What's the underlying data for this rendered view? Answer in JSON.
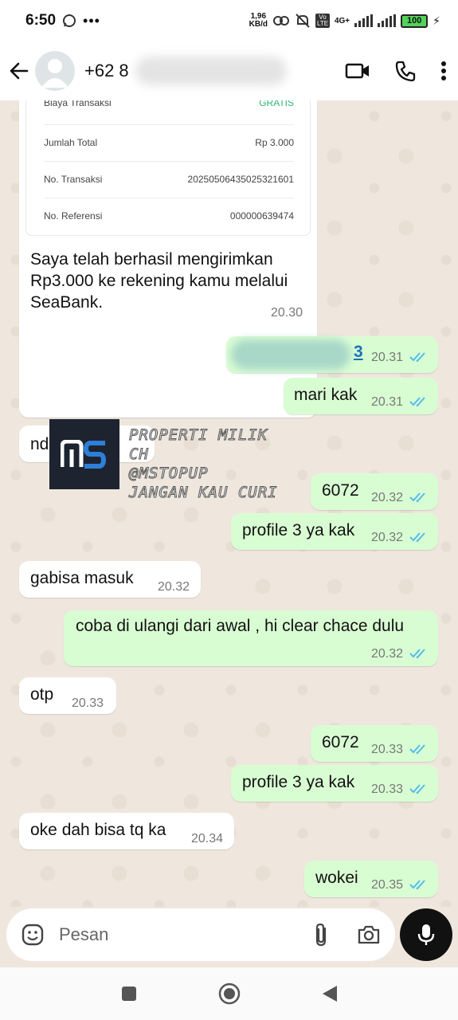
{
  "status_bar": {
    "time": "6:50",
    "net_speed_value": "1,96",
    "net_speed_unit": "KB/d",
    "network": "4G+",
    "volte": "Vo LTE",
    "battery": "100"
  },
  "header": {
    "contact_name": "+62 8"
  },
  "receipt": {
    "rows": [
      {
        "label": "Biaya Transaksi",
        "value": "GRATIS"
      },
      {
        "label": "Jumlah Total",
        "value": "Rp 3.000"
      },
      {
        "label": "No. Transaksi",
        "value": "20250506435025321601"
      },
      {
        "label": "No. Referensi",
        "value": "000000639474"
      }
    ],
    "message": "Saya telah berhasil mengirimkan Rp3.000 ke rekening kamu melalui SeaBank.",
    "time": "20.30"
  },
  "watermark": {
    "line1": "PROPERTI MILIK CH",
    "line2": "@MSTOPUP",
    "line3": "JANGAN KAU CURI"
  },
  "messages": [
    {
      "dir": "out",
      "text": "3",
      "time": "20.31"
    },
    {
      "dir": "out",
      "text": "mari kak",
      "time": "20.31"
    },
    {
      "dir": "in",
      "text": "nd        ak",
      "time": ""
    },
    {
      "dir": "out",
      "text": "6072",
      "time": "20.32"
    },
    {
      "dir": "out",
      "text": "profile 3 ya kak",
      "time": "20.32"
    },
    {
      "dir": "in",
      "text": "gabisa masuk",
      "time": "20.32"
    },
    {
      "dir": "out",
      "text": "coba di ulangi dari awal , hi clear chace dulu",
      "time": "20.32"
    },
    {
      "dir": "in",
      "text": "otp",
      "time": "20.33"
    },
    {
      "dir": "out",
      "text": "6072",
      "time": "20.33"
    },
    {
      "dir": "out",
      "text": "profile 3 ya kak",
      "time": "20.33"
    },
    {
      "dir": "in",
      "text": "oke dah bisa tq ka",
      "time": "20.34"
    },
    {
      "dir": "out",
      "text": "wokei",
      "time": "20.35"
    }
  ],
  "input": {
    "placeholder": "Pesan"
  },
  "colors": {
    "outgoing_bubble": "#d9fdd3",
    "incoming_bubble": "#ffffff",
    "chat_background": "#efe7de",
    "read_ticks": "#53bdeb",
    "gratis": "#2bb673"
  },
  "icons": [
    "back-arrow-icon",
    "video-call-icon",
    "phone-icon",
    "more-vert-icon",
    "emoji-icon",
    "attach-icon",
    "camera-icon",
    "mic-icon",
    "read-ticks-icon"
  ]
}
